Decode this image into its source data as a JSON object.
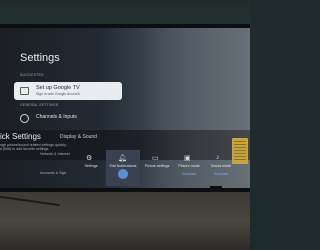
{
  "settings": {
    "title": "Settings",
    "suggested_label": "SUGGESTED",
    "general_label": "GENERAL SETTINGS",
    "setup_title": "Set up Google TV",
    "setup_sub": "Sign in with Google Account",
    "channels_label": "Channels & Inputs"
  },
  "quick": {
    "title": "ick Settings",
    "subtitle": "Display & Sound",
    "desc_line1": "nge picture/sound related settings quickly.",
    "desc_line2": "d [Edit] to add favorite settings.",
    "network_label": "Network & Internet",
    "accounts_label": "Accounts & Sign"
  },
  "tiles": [
    {
      "label": "Settings",
      "value": "",
      "icon": "gear-icon"
    },
    {
      "label": "Edit Notifications",
      "value": "",
      "icon": "bell-icon"
    },
    {
      "label": "Picture settings",
      "value": "",
      "icon": "picture-icon"
    },
    {
      "label": "Picture mode",
      "value": "Standard",
      "icon": "picture-mode-icon"
    },
    {
      "label": "Sound mode",
      "value": "Standard",
      "icon": "sound-icon"
    }
  ],
  "colors": {
    "accent": "#5b8fd6",
    "screen_bg": "#1b1f24"
  }
}
